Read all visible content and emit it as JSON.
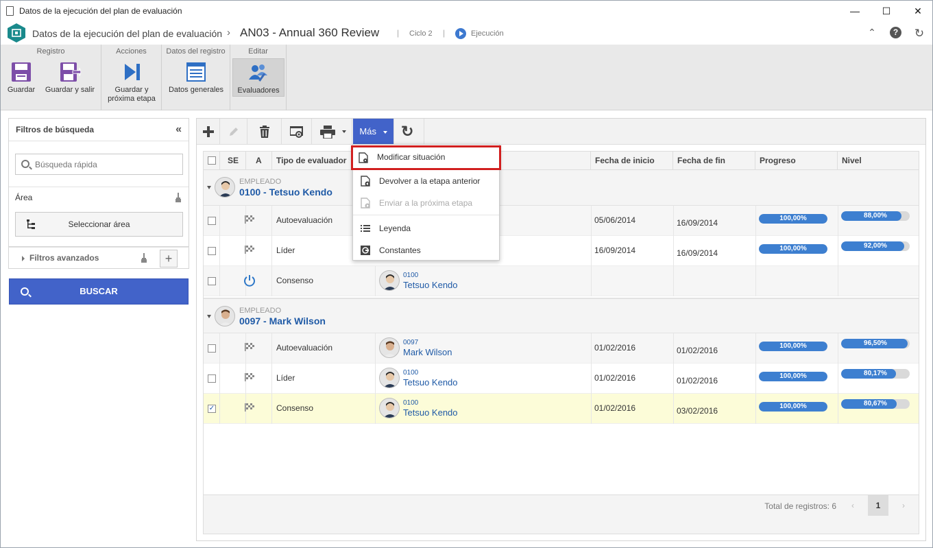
{
  "window": {
    "title": "Datos de la ejecución del plan de evaluación"
  },
  "appbar": {
    "breadcrumb_root": "Datos de la ejecución del plan de evaluación",
    "breadcrumb_sep": "›",
    "record": "AN03 - Annual 360 Review",
    "cycle": "Ciclo 2",
    "status": "Ejecución"
  },
  "ribbon": {
    "groups": {
      "registro": "Registro",
      "acciones": "Acciones",
      "datos": "Datos del registro",
      "editar": "Editar"
    },
    "buttons": {
      "guardar": "Guardar",
      "guardar_salir": "Guardar y salir",
      "guardar_proxima_1": "Guardar y",
      "guardar_proxima_2": "próxima etapa",
      "datos_generales": "Datos generales",
      "evaluadores": "Evaluadores"
    }
  },
  "filters": {
    "title": "Filtros de búsqueda",
    "collapse_glyph": "«",
    "quick_search_placeholder": "Búsqueda rápida",
    "area_label": "Área",
    "select_area": "Seleccionar área",
    "advanced": "Filtros avanzados",
    "search_button": "BUSCAR"
  },
  "toolbar": {
    "mas": "Más"
  },
  "menu": {
    "items": [
      {
        "label": "Modificar situación",
        "icon": "doc-gear-icon",
        "enabled": true
      },
      {
        "label": "Devolver a la etapa anterior",
        "icon": "doc-back-icon",
        "enabled": true
      },
      {
        "label": "Enviar a la próxima etapa",
        "icon": "doc-forward-icon",
        "enabled": false
      },
      {
        "label": "Leyenda",
        "icon": "list-icon",
        "enabled": true
      },
      {
        "label": "Constantes",
        "icon": "constants-icon",
        "enabled": true
      }
    ]
  },
  "grid": {
    "headers": {
      "se": "SE",
      "a": "A",
      "tipo": "Tipo de evaluador",
      "inicio": "Fecha de inicio",
      "fin": "Fecha de fin",
      "progreso": "Progreso",
      "nivel": "Nivel"
    },
    "groups": [
      {
        "label": "EMPLEADO",
        "name": "0100 - Tetsuo Kendo",
        "rows": [
          {
            "tipo": "Autoevaluación",
            "inicio": "05/06/2014",
            "fin": "16/09/2014",
            "progreso": "100,00%",
            "progreso_pct": 100,
            "nivel": "88,00%",
            "nivel_pct": 88
          },
          {
            "tipo": "Líder",
            "inicio": "16/09/2014",
            "fin": "16/09/2014",
            "progreso": "100,00%",
            "progreso_pct": 100,
            "nivel": "92,00%",
            "nivel_pct": 92
          },
          {
            "tipo": "Consenso",
            "evaluator_code": "0100",
            "evaluator_name": "Tetsuo Kendo"
          }
        ]
      },
      {
        "label": "EMPLEADO",
        "name": "0097 - Mark Wilson",
        "rows": [
          {
            "tipo": "Autoevaluación",
            "evaluator_code": "0097",
            "evaluator_name": "Mark Wilson",
            "inicio": "01/02/2016",
            "fin": "01/02/2016",
            "progreso": "100,00%",
            "progreso_pct": 100,
            "nivel": "96,50%",
            "nivel_pct": 96.5
          },
          {
            "tipo": "Líder",
            "evaluator_code": "0100",
            "evaluator_name": "Tetsuo Kendo",
            "inicio": "01/02/2016",
            "fin": "01/02/2016",
            "progreso": "100,00%",
            "progreso_pct": 100,
            "nivel": "80,17%",
            "nivel_pct": 80.17
          },
          {
            "tipo": "Consenso",
            "evaluator_code": "0100",
            "evaluator_name": "Tetsuo Kendo",
            "inicio": "01/02/2016",
            "fin": "03/02/2016",
            "progreso": "100,00%",
            "progreso_pct": 100,
            "nivel": "80,67%",
            "nivel_pct": 80.67,
            "checked": true
          }
        ]
      }
    ],
    "footer": {
      "total": "Total de registros: 6",
      "page": "1",
      "prev": "‹",
      "next": "›"
    }
  },
  "colors": {
    "accent": "#4263c9",
    "progress": "#3d7fd0",
    "link": "#1f5aa6",
    "highlight_row": "#fcfcd8",
    "focus_border": "#d11f1f"
  }
}
